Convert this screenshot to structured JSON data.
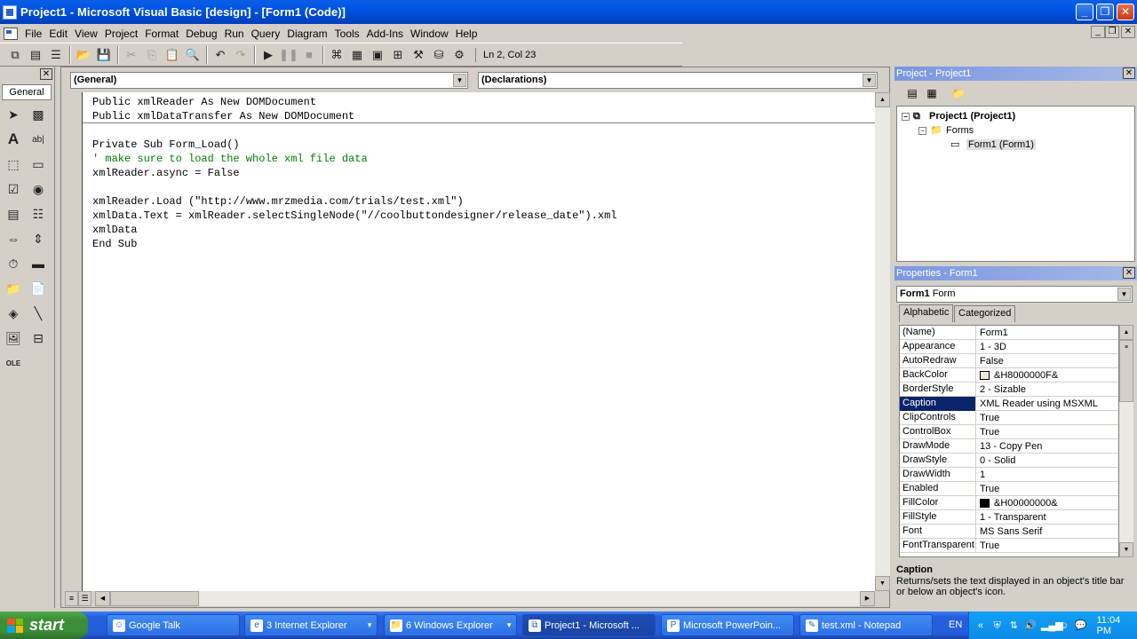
{
  "window": {
    "title": "Project1 - Microsoft Visual Basic [design] - [Form1 (Code)]",
    "min": "_",
    "max": "❐",
    "close": "✕"
  },
  "menu": {
    "items": [
      "File",
      "Edit",
      "View",
      "Project",
      "Format",
      "Debug",
      "Run",
      "Query",
      "Diagram",
      "Tools",
      "Add-Ins",
      "Window",
      "Help"
    ],
    "mdi": {
      "min": "_",
      "restore": "❐",
      "close": "✕"
    }
  },
  "toolbar": {
    "position": "Ln 2, Col 23"
  },
  "toolbox": {
    "tab": "General",
    "close": "✕"
  },
  "code": {
    "object_combo": "(General)",
    "proc_combo": "(Declarations)",
    "declarations": [
      "Public xmlReader As New DOMDocument",
      "Public xmlDataTransfer As New DOMDocument"
    ],
    "lines": [
      {
        "text": "Private Sub Form_Load()",
        "comment": false
      },
      {
        "text": "' make sure to load the whole xml file data",
        "comment": true
      },
      {
        "text": "xmlReader.async = False",
        "comment": false
      },
      {
        "text": "",
        "comment": false
      },
      {
        "text": "xmlReader.Load (\"http://www.mrzmedia.com/trials/test.xml\")",
        "comment": false
      },
      {
        "text": "xmlData.Text = xmlReader.selectSingleNode(\"//coolbuttondesigner/release_date\").xml",
        "comment": false
      },
      {
        "text": "xmlData",
        "comment": false
      },
      {
        "text": "End Sub",
        "comment": false
      }
    ]
  },
  "project": {
    "title": "Project - Project1",
    "close": "✕",
    "root": "Project1 (Project1)",
    "folder": "Forms",
    "form": "Form1 (Form1)"
  },
  "properties": {
    "title": "Properties - Form1",
    "close": "✕",
    "object_name": "Form1",
    "object_type": "Form",
    "tab_alphabetic": "Alphabetic",
    "tab_categorized": "Categorized",
    "rows": [
      {
        "name": "(Name)",
        "value": "Form1"
      },
      {
        "name": "Appearance",
        "value": "1 - 3D"
      },
      {
        "name": "AutoRedraw",
        "value": "False"
      },
      {
        "name": "BackColor",
        "value": "&H8000000F&",
        "swatch": "#ece9d8"
      },
      {
        "name": "BorderStyle",
        "value": "2 - Sizable"
      },
      {
        "name": "Caption",
        "value": "XML Reader using MSXML",
        "selected": true
      },
      {
        "name": "ClipControls",
        "value": "True"
      },
      {
        "name": "ControlBox",
        "value": "True"
      },
      {
        "name": "DrawMode",
        "value": "13 - Copy Pen"
      },
      {
        "name": "DrawStyle",
        "value": "0 - Solid"
      },
      {
        "name": "DrawWidth",
        "value": "1"
      },
      {
        "name": "Enabled",
        "value": "True"
      },
      {
        "name": "FillColor",
        "value": "&H00000000&",
        "swatch": "#000000"
      },
      {
        "name": "FillStyle",
        "value": "1 - Transparent"
      },
      {
        "name": "Font",
        "value": "MS Sans Serif"
      },
      {
        "name": "FontTransparent",
        "value": "True"
      }
    ],
    "desc_title": "Caption",
    "desc_text": "Returns/sets the text displayed in an object's title bar or below an object's icon."
  },
  "taskbar": {
    "start": "start",
    "buttons": [
      {
        "label": "Google Talk",
        "active": false,
        "group": false
      },
      {
        "label": "3 Internet Explorer",
        "active": false,
        "group": true
      },
      {
        "label": "6 Windows Explorer",
        "active": false,
        "group": true
      },
      {
        "label": "Project1 - Microsoft ...",
        "active": true,
        "group": false
      },
      {
        "label": "Microsoft PowerPoin...",
        "active": false,
        "group": false
      },
      {
        "label": "test.xml - Notepad",
        "active": false,
        "group": false
      }
    ],
    "lang": "EN",
    "clock": "11:04 PM"
  },
  "colors": {
    "title_blue": "#0054e3",
    "comment_green": "#008000",
    "selection": "#0a246a",
    "start_green": "#3c8f36",
    "taskbar_blue": "#245edb"
  }
}
